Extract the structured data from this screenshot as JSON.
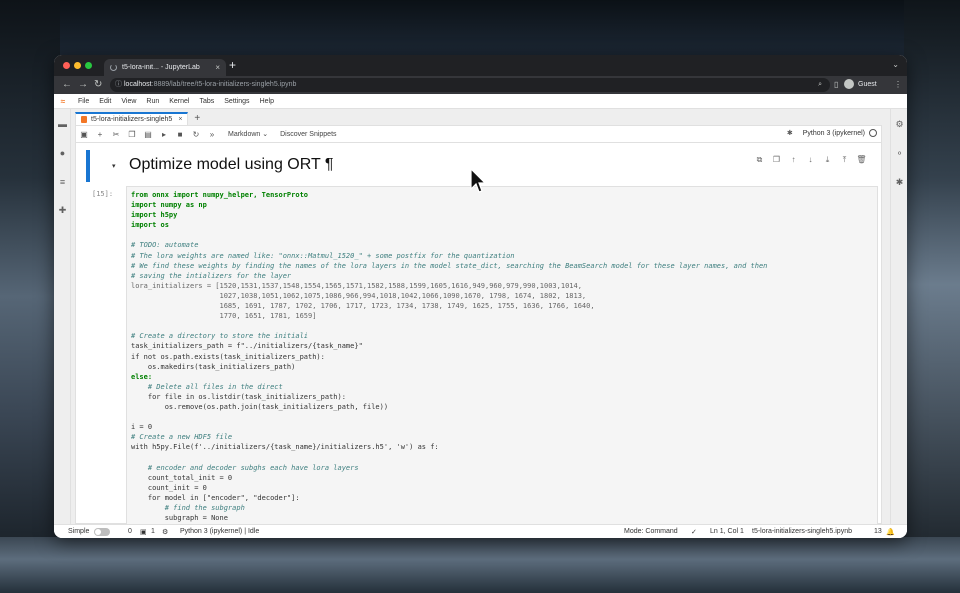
{
  "browser": {
    "tab_title": "t5-lora-init... - JupyterLab",
    "tab_close": "×",
    "new_tab": "+",
    "tab_menu": "⌄",
    "url_host": "localhost",
    "url_path": ":8889/lab/tree/t5-lora-initializers-singleh5.ipynb",
    "profile_label": "Guest"
  },
  "menubar": {
    "items": [
      "File",
      "Edit",
      "View",
      "Run",
      "Kernel",
      "Tabs",
      "Settings",
      "Help"
    ]
  },
  "notebook_tab": {
    "label": "t5-lora-initializers-singleh5",
    "close": "×",
    "add": "+"
  },
  "toolbar": {
    "cell_type": "Markdown ⌄",
    "discover": "Discover Snippets",
    "kernel": "Python 3 (ipykernel)"
  },
  "markdown_cell": {
    "heading": "Optimize model using ORT ¶",
    "caret": "▾"
  },
  "code_cell": {
    "prompt": "[15]:",
    "lines": [
      {
        "t": "from onnx import numpy_helper, TensorProto",
        "k": "k"
      },
      {
        "t": "import numpy as np",
        "k": "k"
      },
      {
        "t": "import h5py",
        "k": "k"
      },
      {
        "t": "import os",
        "k": "k"
      },
      {
        "t": "",
        "k": ""
      },
      {
        "t": "# TODO: automate",
        "k": "c"
      },
      {
        "t": "# The lora weights are named like: \"onnx::Matmul_1520_\" + some postfix for the quantization",
        "k": "c"
      },
      {
        "t": "# We find these weights by finding the names of the lora layers in the model state_dict, searching the BeamSearch model for these layer names, and then",
        "k": "c"
      },
      {
        "t": "# saving the intializers for the layer",
        "k": "c"
      },
      {
        "t": "lora_initializers = [1520,1531,1537,1548,1554,1565,1571,1582,1588,1599,1605,1616,949,960,979,990,1003,1014,",
        "k": "n"
      },
      {
        "t": "                     1027,1038,1051,1062,1075,1086,966,994,1018,1042,1066,1090,1670, 1798, 1674, 1802, 1813,",
        "k": "n"
      },
      {
        "t": "                     1685, 1691, 1787, 1702, 1706, 1717, 1723, 1734, 1738, 1749, 1625, 1755, 1636, 1766, 1640,",
        "k": "n"
      },
      {
        "t": "                     1770, 1651, 1781, 1659]",
        "k": "n"
      },
      {
        "t": "",
        "k": ""
      },
      {
        "t": "# Create a directory to store the initiali",
        "k": "c"
      },
      {
        "t": "task_initializers_path = f\"../initializers/{task_name}\"",
        "k": ""
      },
      {
        "t": "if not os.path.exists(task_initializers_path):",
        "k": ""
      },
      {
        "t": "    os.makedirs(task_initializers_path)",
        "k": ""
      },
      {
        "t": "else:",
        "k": "k"
      },
      {
        "t": "    # Delete all files in the direct",
        "k": "c"
      },
      {
        "t": "    for file in os.listdir(task_initializers_path):",
        "k": ""
      },
      {
        "t": "        os.remove(os.path.join(task_initializers_path, file))",
        "k": ""
      },
      {
        "t": "",
        "k": ""
      },
      {
        "t": "i = 0",
        "k": ""
      },
      {
        "t": "# Create a new HDF5 file",
        "k": "c"
      },
      {
        "t": "with h5py.File(f'../initializers/{task_name}/initializers.h5', 'w') as f:",
        "k": ""
      },
      {
        "t": "",
        "k": ""
      },
      {
        "t": "    # encoder and decoder subghs each have lora layers",
        "k": "c"
      },
      {
        "t": "    count_total_init = 0",
        "k": ""
      },
      {
        "t": "    count_init = 0",
        "k": ""
      },
      {
        "t": "    for model in [\"encoder\", \"decoder\"]:",
        "k": ""
      },
      {
        "t": "        # find the subgraph",
        "k": "c"
      },
      {
        "t": "        subgraph = None",
        "k": ""
      }
    ]
  },
  "statusbar": {
    "mode_label": "Simple",
    "zero": "0",
    "term_count": "1",
    "kernel_status": "Python 3 (ipykernel) | Idle",
    "mode": "Mode: Command",
    "position": "Ln 1, Col 1",
    "filename": "t5-lora-initializers-singleh5.ipynb",
    "notifications": "13"
  },
  "colors": {
    "accent": "#1976d2",
    "jupyter_orange": "#f37726",
    "keyword": "#008000",
    "comment": "#408080"
  }
}
